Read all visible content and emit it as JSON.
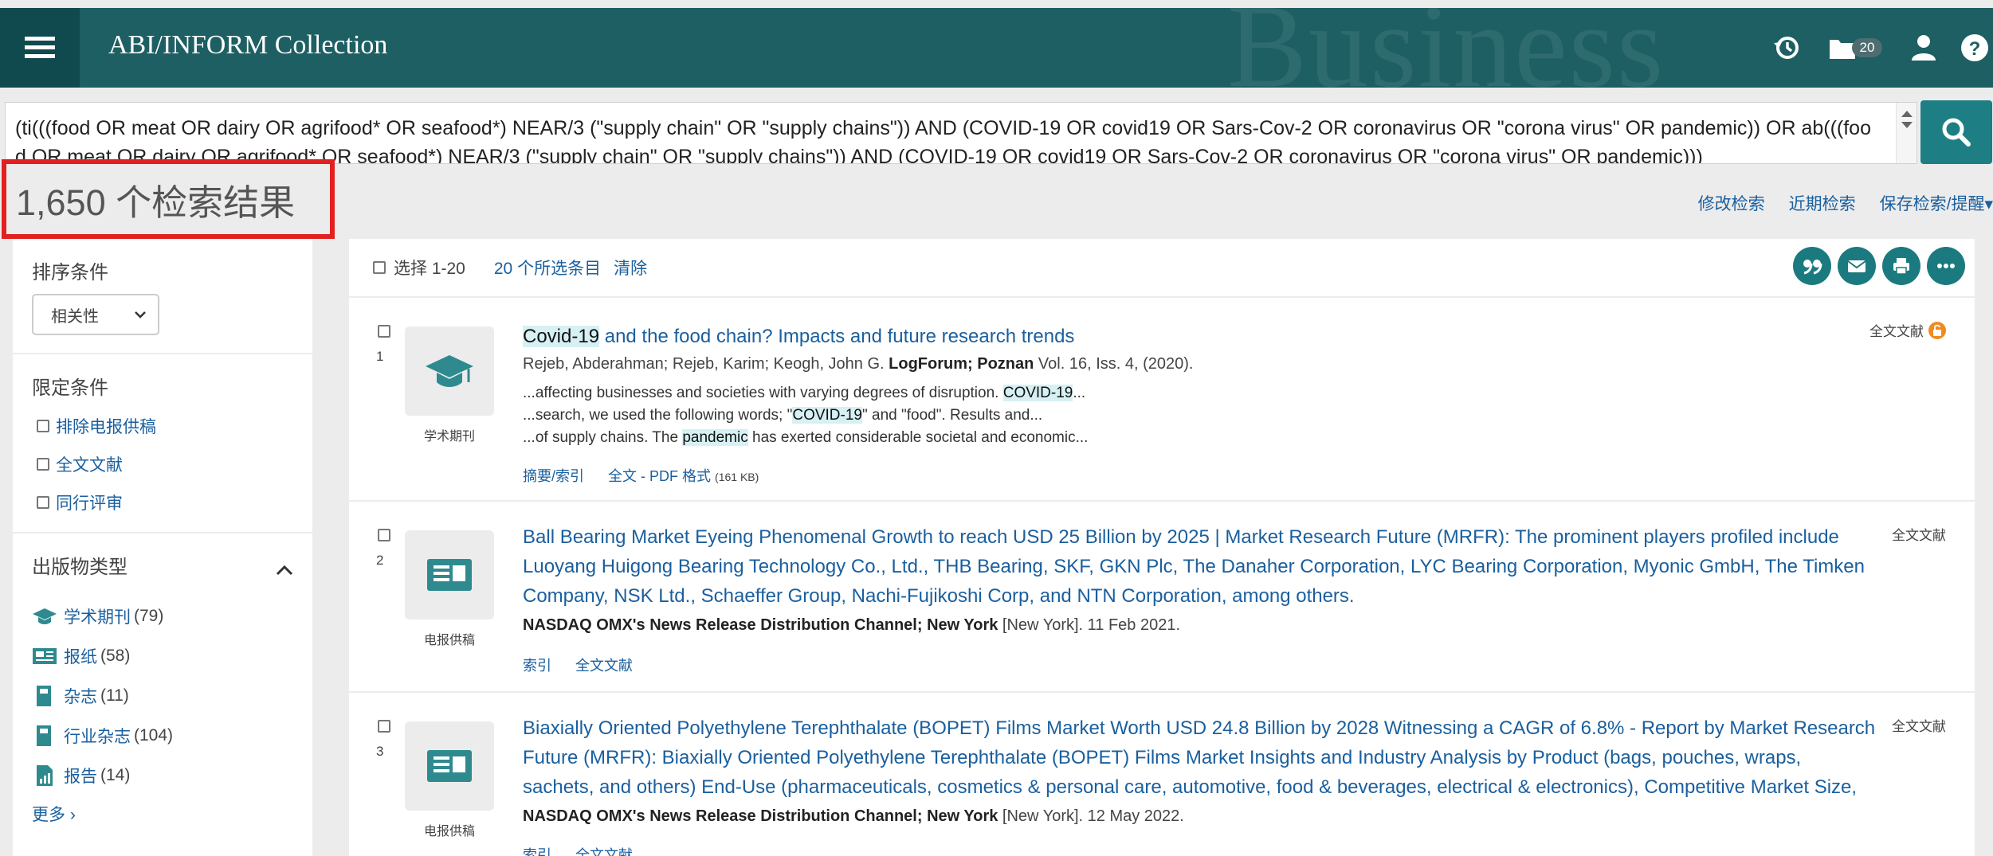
{
  "header": {
    "app_title": "ABI/INFORM Collection",
    "watermark": "Business",
    "folder_count": "20"
  },
  "search": {
    "query": "(ti(((food OR meat OR dairy OR agrifood* OR seafood*) NEAR/3 (\"supply chain\" OR \"supply chains\")) AND (COVID-19 OR covid19 OR Sars-Cov-2 OR coronavirus OR \"corona virus\" OR pandemic)) OR ab(((food OR meat OR dairy OR agrifood* OR seafood*) NEAR/3 (\"supply chain\" OR \"supply chains\")) AND (COVID-19 OR covid19 OR Sars-Cov-2 OR coronavirus OR \"corona virus\" OR pandemic)))"
  },
  "results_count": "1,650 个检索结果",
  "search_links": {
    "modify": "修改检索",
    "recent": "近期检索",
    "save_alert": "保存检索/提醒▾"
  },
  "sidebar": {
    "sort_title": "排序条件",
    "sort_value": "相关性",
    "limit_title": "限定条件",
    "limits": [
      "排除电报供稿",
      "全文文献",
      "同行评审"
    ],
    "pub_type_title": "出版物类型",
    "pub_types": [
      {
        "label": "学术期刊",
        "count": "(79)"
      },
      {
        "label": "报纸",
        "count": "(58)"
      },
      {
        "label": "杂志",
        "count": "(11)"
      },
      {
        "label": "行业杂志",
        "count": "(104)"
      },
      {
        "label": "报告",
        "count": "(14)"
      }
    ],
    "more": "更多 ›"
  },
  "main": {
    "select_range": "选择 1-20",
    "selected_items": "20 个所选条目",
    "clear": "清除"
  },
  "results": [
    {
      "num": "1",
      "type_label": "学术期刊",
      "title_hl_1": "Covid-19",
      "title_rest": " and the food chain? Impacts and future research trends",
      "authors": "Rejeb, Abderahman; Rejeb, Karim; Keogh, John G. ",
      "journal": "LogForum; Poznan",
      "journal_detail": " Vol. 16, Iss. 4,  (2020).",
      "snippet_1a": "...affecting businesses and societies with varying degrees of disruption. ",
      "snippet_1hl": "COVID-19",
      "snippet_1b": "...",
      "snippet_2a": "...search, we used the following words; \"",
      "snippet_2hl": "COVID-19",
      "snippet_2b": "\" and \"food\". Results and...",
      "snippet_3a": "...of supply chains. The ",
      "snippet_3hl": "pandemic",
      "snippet_3b": " has exerted considerable societal and economic...",
      "link_1": "摘要/索引",
      "link_2": "全文 - PDF 格式",
      "link_2_size": "(161 KB)",
      "fulltext": "全文文献"
    },
    {
      "num": "2",
      "type_label": "电报供稿",
      "title": "Ball Bearing Market Eyeing Phenomenal Growth to reach USD 25 Billion by 2025 | Market Research Future (MRFR): The prominent players profiled include Luoyang Huigong Bearing Technology Co., Ltd., THB Bearing, SKF, GKN Plc, The Danaher Corporation, LYC Bearing Corporation, Myonic GmbH, The Timken Company, NSK Ltd., Schaeffer Group, Nachi-Fujikoshi Corp, and NTN Corporation, among others.",
      "source": "NASDAQ OMX's News Release Distribution Channel; New York",
      "source_detail": " [New York]. 11 Feb 2021.",
      "link_1": "索引",
      "link_2": "全文文献",
      "fulltext": "全文文献"
    },
    {
      "num": "3",
      "type_label": "电报供稿",
      "title": "Biaxially Oriented Polyethylene Terephthalate (BOPET) Films Market Worth USD 24.8 Billion by 2028 Witnessing a CAGR of 6.8% - Report by Market Research Future (MRFR): Biaxially Oriented Polyethylene Terephthalate (BOPET) Films Market Insights and Industry Analysis by Product (bags, pouches, wraps, sachets, and others) End-Use (pharmaceuticals, cosmetics & personal care, automotive, food & beverages, electrical & electronics), Competitive Market Size, ...",
      "source": "NASDAQ OMX's News Release Distribution Channel; New York",
      "source_detail": " [New York]. 12 May 2022.",
      "link_1": "索引",
      "link_2": "全文文献",
      "fulltext": "全文文献"
    }
  ],
  "colors": {
    "header_bg": "#1d5f63",
    "menu_bg": "#114a4e",
    "accent": "#1b7a7f",
    "link": "#1a5f9e",
    "highlight_box": "#e32020"
  }
}
